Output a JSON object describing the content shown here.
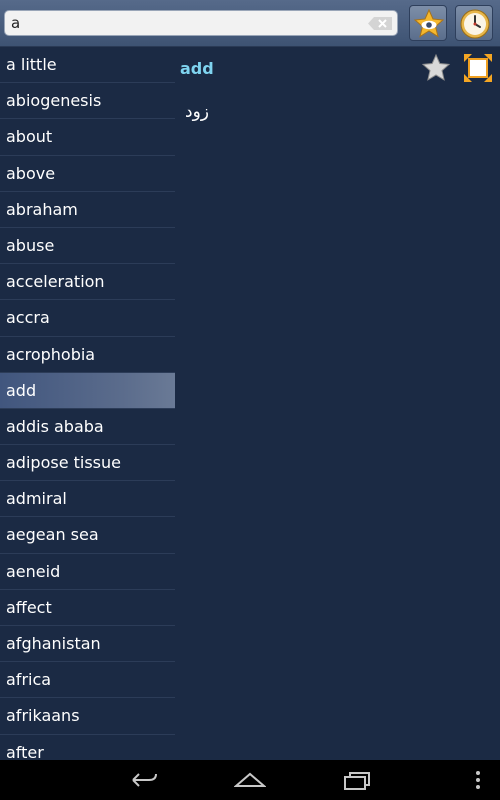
{
  "search": {
    "value": "a",
    "placeholder": ""
  },
  "toolbar": {
    "favorites_icon": "star-eye-icon",
    "history_icon": "clock-icon"
  },
  "word_list": [
    "a little",
    "abiogenesis",
    "about",
    "above",
    "abraham",
    "abuse",
    "acceleration",
    "accra",
    "acrophobia",
    "add",
    "addis ababa",
    "adipose tissue",
    "admiral",
    "aegean sea",
    "aeneid",
    "affect",
    "afghanistan",
    "africa",
    "afrikaans",
    "after"
  ],
  "selected_index": 9,
  "entry": {
    "headword": "add",
    "translation": "زود"
  },
  "colors": {
    "headword": "#7fd4f0",
    "background": "#1b2a44",
    "star": "#f5b82e"
  }
}
